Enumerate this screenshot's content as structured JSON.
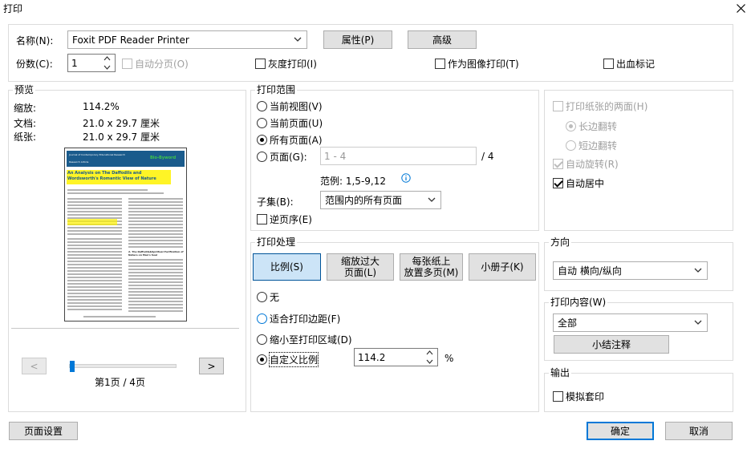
{
  "window": {
    "title": "打印"
  },
  "printer": {
    "name_label": "名称(N):",
    "selected": "Foxit PDF Reader Printer",
    "properties_button": "属性(P)",
    "advanced_button": "高级",
    "copies_label": "份数(C):",
    "copies_value": "1",
    "collate_label": "自动分页(O)",
    "grayscale_label": "灰度打印(I)",
    "print_as_image_label": "作为图像打印(T)",
    "bleed_marks_label": "出血标记"
  },
  "preview": {
    "title": "预览",
    "scale_label": "缩放:",
    "scale_value": "114.2%",
    "document_label": "文档:",
    "document_value": "21.0 x 29.7 厘米",
    "paper_label": "纸张:",
    "paper_value": "21.0 x 29.7 厘米",
    "thumbnail": {
      "journal": "Journal of Contemporary Educational Research",
      "journal_sub": "Research Article",
      "brand": "Bio-Byword",
      "article_title": "An Analysis on The Daffodils and Wordsworth's Romantic View of Nature",
      "section_heading": "2. The Daffodils&Spiritual Purification of Nature on Man's Soul"
    },
    "prev_button": "<",
    "next_button": ">",
    "page_indicator": "第1页 / 4页",
    "slider_value": 0.0
  },
  "print_range": {
    "title": "打印范围",
    "current_view": "当前视图(V)",
    "current_page": "当前页面(U)",
    "all_pages": "所有页面(A)",
    "pages": "页面(G):",
    "pages_placeholder": "1 - 4",
    "total_pages": "/ 4",
    "example": "范例:  1,5-9,12",
    "subset_label": "子集(B):",
    "subset_value": "范围内的所有页面",
    "reverse_label": "逆页序(E)"
  },
  "duplex": {
    "both_sides": "打印纸张的两面(H)",
    "long_edge": "长边翻转",
    "short_edge": "短边翻转",
    "auto_rotate": "自动旋转(R)",
    "auto_center": "自动居中"
  },
  "handling": {
    "title": "打印处理",
    "tab_scale": "比例(S)",
    "tab_tile_line1": "缩放过大",
    "tab_tile_line2": "页面(L)",
    "tab_multi_line1": "每张纸上",
    "tab_multi_line2": "放置多页(M)",
    "tab_booklet": "小册子(K)",
    "none": "无",
    "fit_margins": "适合打印边距(F)",
    "shrink": "缩小至打印区域(D)",
    "custom": "自定义比例",
    "custom_value": "114.2",
    "percent": "%"
  },
  "orientation": {
    "title": "方向",
    "selected": "自动 横向/纵向"
  },
  "print_what": {
    "title": "打印内容(W)",
    "selected": "全部",
    "summarize_button": "小结注释"
  },
  "output": {
    "title": "输出",
    "simulate_overprint": "模拟套印"
  },
  "footer": {
    "page_setup": "页面设置",
    "ok": "确定",
    "cancel": "取消"
  }
}
